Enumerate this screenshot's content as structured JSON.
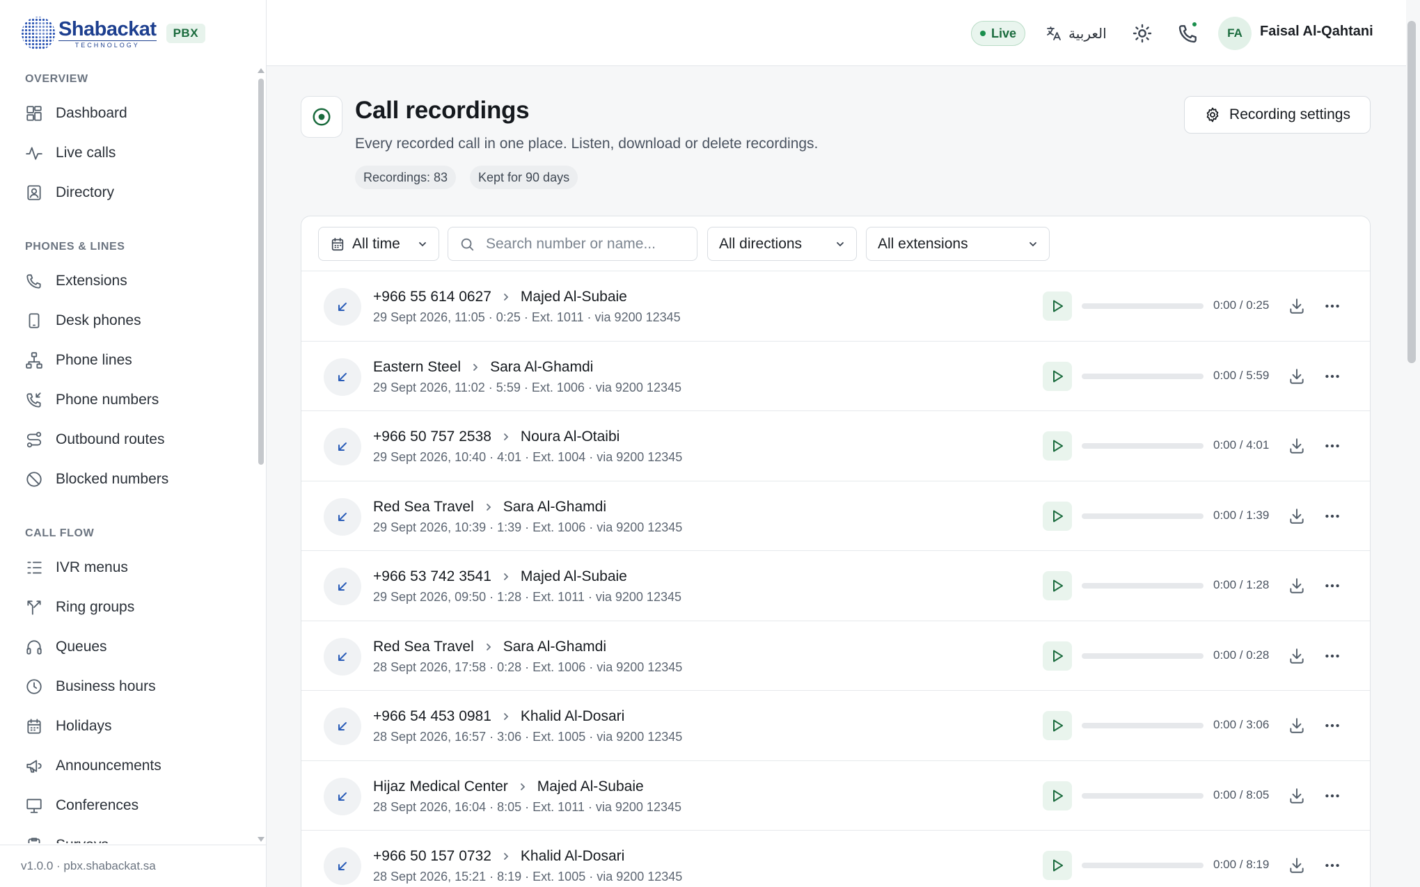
{
  "brand": {
    "name": "Shabackat",
    "tagline": "TECHNOLOGY",
    "badge": "PBX"
  },
  "sidebar": {
    "sections": [
      {
        "title": "OVERVIEW",
        "items": [
          {
            "label": "Dashboard",
            "icon": "dashboard-icon"
          },
          {
            "label": "Live calls",
            "icon": "activity-icon"
          },
          {
            "label": "Directory",
            "icon": "contact-book-icon"
          }
        ]
      },
      {
        "title": "PHONES & LINES",
        "items": [
          {
            "label": "Extensions",
            "icon": "phone-icon"
          },
          {
            "label": "Desk phones",
            "icon": "device-icon"
          },
          {
            "label": "Phone lines",
            "icon": "network-icon"
          },
          {
            "label": "Phone numbers",
            "icon": "phone-incoming-icon"
          },
          {
            "label": "Outbound routes",
            "icon": "route-icon"
          },
          {
            "label": "Blocked numbers",
            "icon": "ban-icon"
          }
        ]
      },
      {
        "title": "CALL FLOW",
        "items": [
          {
            "label": "IVR menus",
            "icon": "list-tree-icon"
          },
          {
            "label": "Ring groups",
            "icon": "split-icon"
          },
          {
            "label": "Queues",
            "icon": "headphones-icon"
          },
          {
            "label": "Business hours",
            "icon": "clock-icon"
          },
          {
            "label": "Holidays",
            "icon": "calendar-icon"
          },
          {
            "label": "Announcements",
            "icon": "megaphone-icon"
          },
          {
            "label": "Conferences",
            "icon": "presentation-icon"
          },
          {
            "label": "Surveys",
            "icon": "clipboard-check-icon"
          }
        ]
      }
    ],
    "footer": "v1.0.0 · pbx.shabackat.sa"
  },
  "topbar": {
    "live_label": "Live",
    "language_label": "العربية",
    "user_initials": "FA",
    "user_name": "Faisal Al-Qahtani"
  },
  "header": {
    "title": "Call recordings",
    "subtitle": "Every recorded call in one place. Listen, download or delete recordings.",
    "tags": [
      "Recordings: 83",
      "Kept for 90 days"
    ],
    "settings_button": "Recording settings"
  },
  "filters": {
    "time": "All time",
    "search_placeholder": "Search number or name...",
    "direction": "All directions",
    "extension": "All extensions"
  },
  "recordings": [
    {
      "from": "+966 55 614 0627",
      "to": "Majed Al-Subaie",
      "meta": "29 Sept 2026, 11:05 · 0:25 · Ext. 1011 · via 9200 12345",
      "time": "0:00 / 0:25",
      "progress": 0
    },
    {
      "from": "Eastern Steel",
      "to": "Sara Al-Ghamdi",
      "meta": "29 Sept 2026, 11:02 · 5:59 · Ext. 1006 · via 9200 12345",
      "time": "0:00 / 5:59",
      "progress": 0
    },
    {
      "from": "+966 50 757 2538",
      "to": "Noura Al-Otaibi",
      "meta": "29 Sept 2026, 10:40 · 4:01 · Ext. 1004 · via 9200 12345",
      "time": "0:00 / 4:01",
      "progress": 0
    },
    {
      "from": "Red Sea Travel",
      "to": "Sara Al-Ghamdi",
      "meta": "29 Sept 2026, 10:39 · 1:39 · Ext. 1006 · via 9200 12345",
      "time": "0:00 / 1:39",
      "progress": 0
    },
    {
      "from": "+966 53 742 3541",
      "to": "Majed Al-Subaie",
      "meta": "29 Sept 2026, 09:50 · 1:28 · Ext. 1011 · via 9200 12345",
      "time": "0:00 / 1:28",
      "progress": 0
    },
    {
      "from": "Red Sea Travel",
      "to": "Sara Al-Ghamdi",
      "meta": "28 Sept 2026, 17:58 · 0:28 · Ext. 1006 · via 9200 12345",
      "time": "0:00 / 0:28",
      "progress": 0
    },
    {
      "from": "+966 54 453 0981",
      "to": "Khalid Al-Dosari",
      "meta": "28 Sept 2026, 16:57 · 3:06 · Ext. 1005 · via 9200 12345",
      "time": "0:00 / 3:06",
      "progress": 0
    },
    {
      "from": "Hijaz Medical Center",
      "to": "Majed Al-Subaie",
      "meta": "28 Sept 2026, 16:04 · 8:05 · Ext. 1011 · via 9200 12345",
      "time": "0:00 / 8:05",
      "progress": 0
    },
    {
      "from": "+966 50 157 0732",
      "to": "Khalid Al-Dosari",
      "meta": "28 Sept 2026, 15:21 · 8:19 · Ext. 1005 · via 9200 12345",
      "time": "0:00 / 8:19",
      "progress": 0
    }
  ],
  "colors": {
    "accent": "#1a6b3d",
    "brand": "#1d3f8f",
    "direction_icon": "#2a5db8"
  }
}
